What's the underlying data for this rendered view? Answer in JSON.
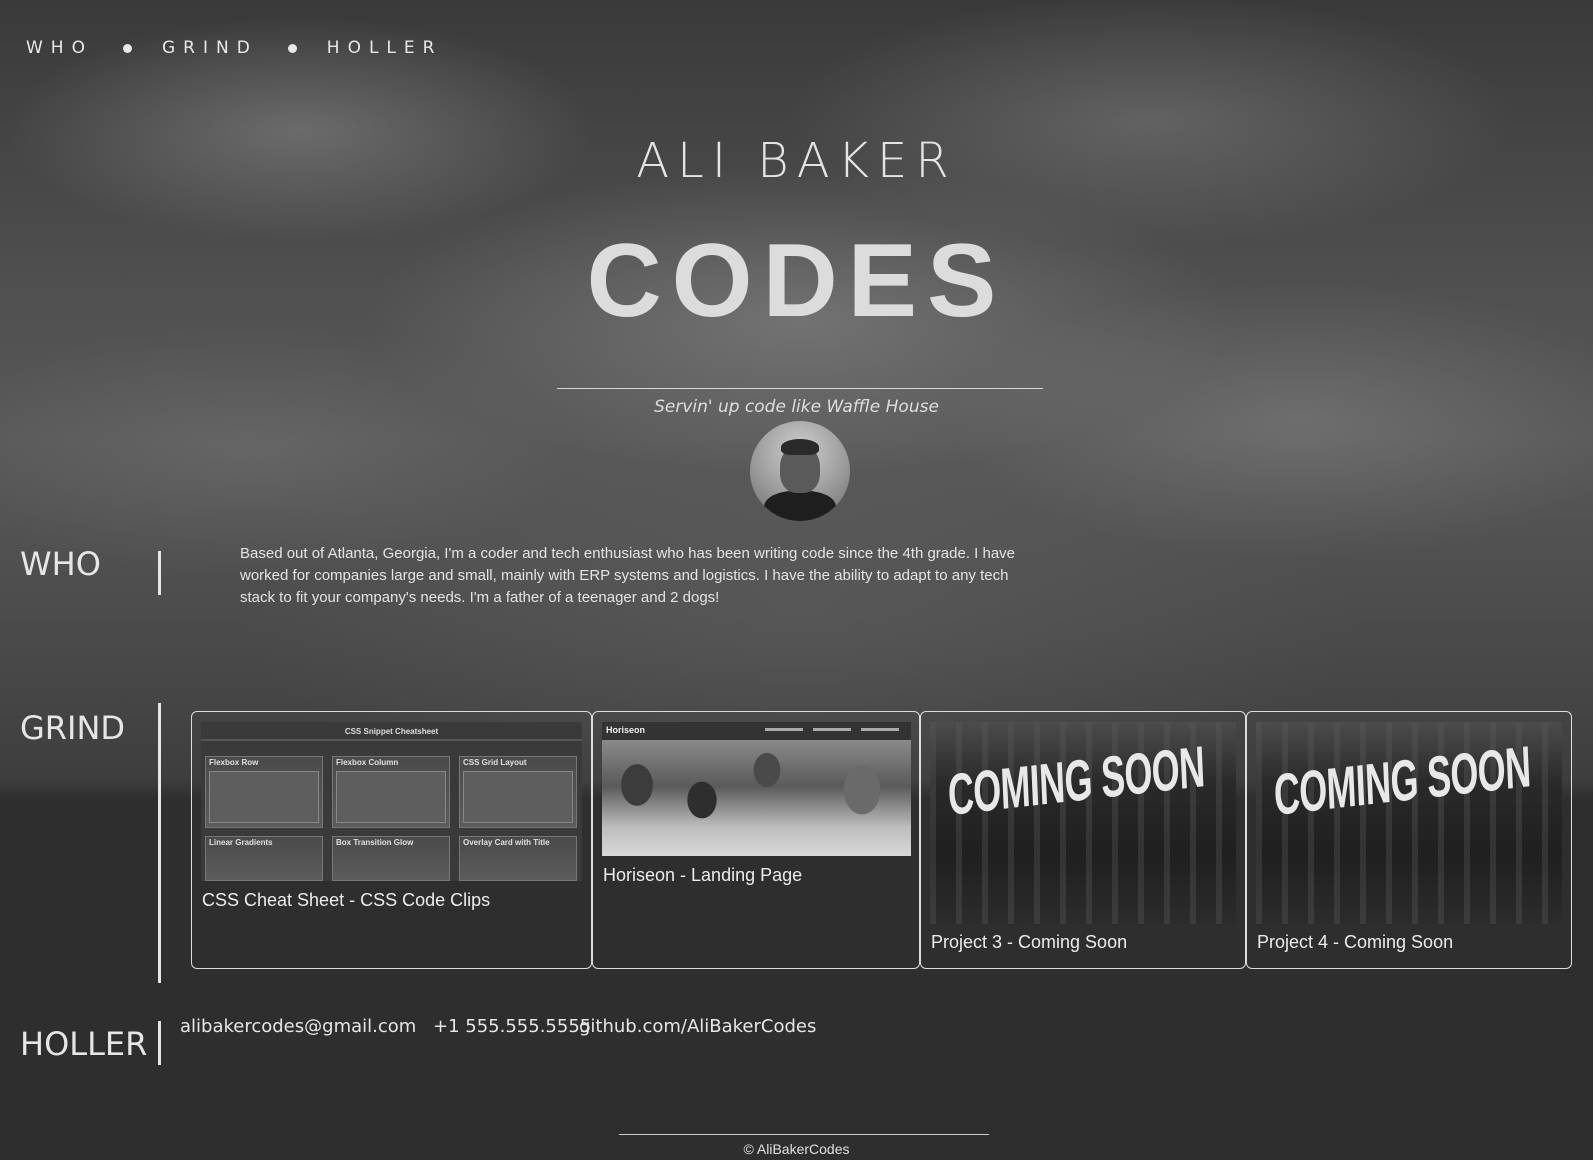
{
  "nav": {
    "items": [
      {
        "label": "WHO"
      },
      {
        "label": "GRIND"
      },
      {
        "label": "HOLLER"
      }
    ]
  },
  "hero": {
    "subtitle": "ALI BAKER",
    "title": "CODES",
    "tagline": "Servin' up code like Waffle House"
  },
  "who": {
    "heading": "WHO",
    "bio": "Based out of Atlanta, Georgia, I'm a coder and tech enthusiast who has been writing code since the 4th grade. I have worked for companies large and small, mainly with ERP systems and logistics. I have the ability to adapt to any tech stack to fit your company's needs. I'm a father of a teenager and 2 dogs!"
  },
  "grind": {
    "heading": "GRIND",
    "projects": [
      {
        "caption": "CSS Cheat Sheet - CSS Code Clips",
        "thumb": {
          "title": "CSS Snippet Cheatsheet",
          "boxes": [
            "Flexbox Row",
            "Flexbox Column",
            "CSS Grid Layout",
            "Linear Gradients",
            "Box Transition Glow",
            "Overlay Card with Title"
          ]
        }
      },
      {
        "caption": "Horiseon - Landing Page",
        "thumb": {
          "logo": "Horiseon"
        }
      },
      {
        "caption": "Project 3 - Coming Soon",
        "thumb": {
          "text": "COMING SOON"
        }
      },
      {
        "caption": "Project 4 - Coming Soon",
        "thumb": {
          "text": "COMING SOON"
        }
      }
    ]
  },
  "holler": {
    "heading": "HOLLER",
    "email": "alibakercodes@gmail.com",
    "phone": "+1 555.555.5555",
    "github": "github.com/AliBakerCodes"
  },
  "footer": {
    "copyright": "© AliBakerCodes"
  },
  "colors": {
    "background": "#2e2e2e",
    "text": "#e6e6e6",
    "card_border": "#dcdcdc"
  }
}
